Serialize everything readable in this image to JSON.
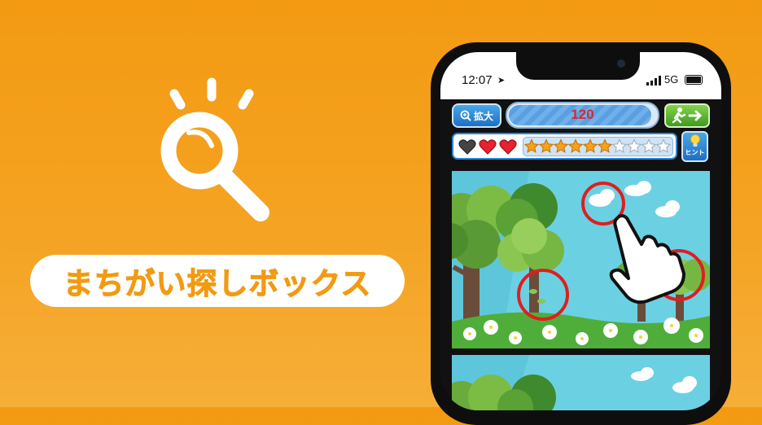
{
  "promo": {
    "title": "まちがい探しボックス",
    "icon": "magnifier-icon"
  },
  "status_bar": {
    "time": "12:07",
    "network": "5G"
  },
  "game": {
    "zoom_label": "拡大",
    "score": "120",
    "score_progress": 0.97,
    "hint_label": "ヒント",
    "lives_total": 3,
    "lives_remaining": 2,
    "stars_total": 10,
    "stars_earned": 6
  },
  "colors": {
    "background": "#f39a12",
    "title_text": "#f29a12",
    "score_text": "#e0262d",
    "ui_blue": "#2a86d8",
    "exit_green": "#4fae28",
    "circle_red": "#e01e1e"
  }
}
